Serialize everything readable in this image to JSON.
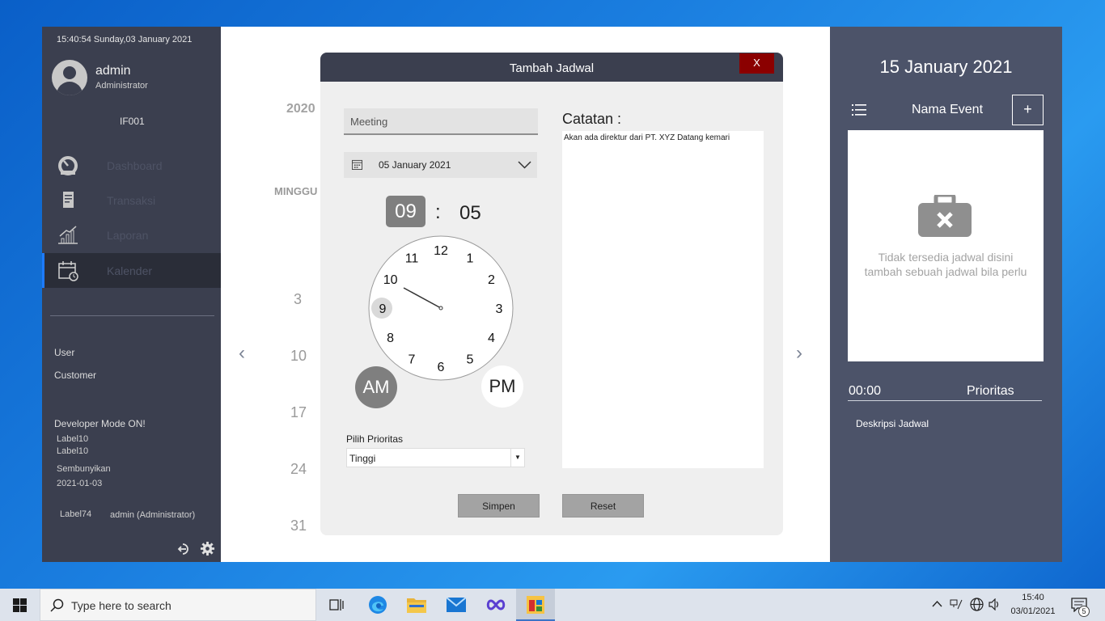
{
  "sidebar": {
    "datetime": "15:40:54  Sunday,03 January 2021",
    "user_name": "admin",
    "user_role": "Administrator",
    "user_code": "IF001",
    "nav": [
      {
        "label": "Dashboard",
        "icon": "gauge-icon"
      },
      {
        "label": "Transaksi",
        "icon": "receipt-icon"
      },
      {
        "label": "Laporan",
        "icon": "chart-growth-icon"
      },
      {
        "label": "Kalender",
        "icon": "calendar-clock-icon"
      }
    ],
    "links": [
      "User",
      "Customer"
    ],
    "dev_mode": "Developer Mode ON!",
    "label10a": "Label10",
    "label10b": "Label10",
    "hide": "Sembunyikan",
    "date": "2021-01-03",
    "label74": "Label74",
    "account": "admin (Administrator)"
  },
  "calendar": {
    "year": "2020",
    "week_header": "MINGGU",
    "day_numbers": [
      "3",
      "10",
      "17",
      "24",
      "31"
    ],
    "prev": "‹",
    "next": "›"
  },
  "right_panel": {
    "date": "15 January 2021",
    "title": "Nama Event",
    "add": "+",
    "empty_line1": "Tidak tersedia jadwal disini",
    "empty_line2": "tambah sebuah jadwal bila perlu",
    "time": "00:00",
    "priority": "Prioritas",
    "desc": "Deskripsi Jadwal"
  },
  "dialog": {
    "title": "Tambah Jadwal",
    "close": "X",
    "event_name": "Meeting",
    "date": "05 January 2021",
    "hour": "09",
    "colon": ":",
    "minute": "05",
    "clock_numbers": [
      "12",
      "1",
      "2",
      "3",
      "4",
      "5",
      "6",
      "7",
      "8",
      "9",
      "10",
      "11"
    ],
    "am": "AM",
    "pm": "PM",
    "priority_label": "Pilih Prioritas",
    "priority_value": "Tinggi",
    "notes_label": "Catatan :",
    "notes_value": "Akan ada direktur dari PT. XYZ Datang kemari",
    "save": "Simpen",
    "reset": "Reset"
  },
  "taskbar": {
    "search_placeholder": "Type here to search",
    "time": "15:40",
    "date": "03/01/2021",
    "notifications": "5"
  }
}
